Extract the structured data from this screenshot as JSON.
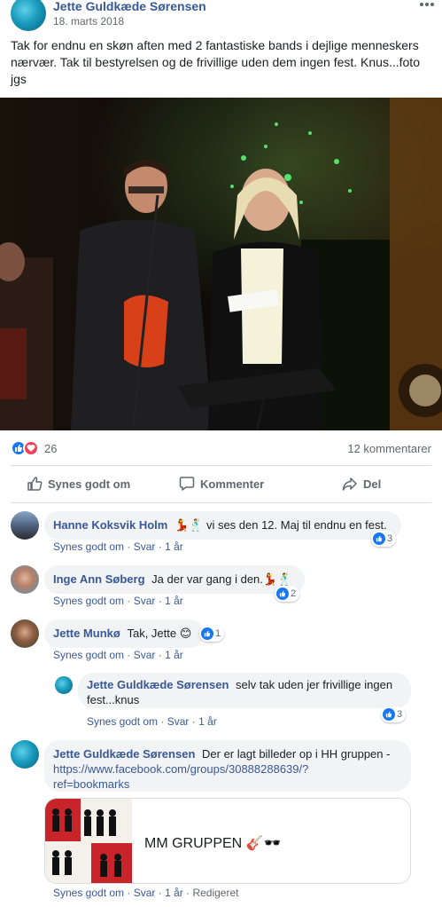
{
  "post": {
    "author": "Jette Guldkæde Sørensen",
    "date": "18. marts 2018",
    "text": "Tak for endnu en skøn aften med 2 fantastiske bands i dejlige menneskers nærvær. Tak til bestyrelsen og de frivillige uden dem ingen fest. Knus...foto jgs",
    "more_icon": "more-dots-icon",
    "reaction_count": "26",
    "comment_count": "12 kommentarer",
    "actions": {
      "like": "Synes godt om",
      "comment": "Kommenter",
      "share": "Del"
    }
  },
  "comments": [
    {
      "author": "Hanne Koksvik Holm",
      "text": "💃🕺 vi ses den 12. Maj til endnu en fest.",
      "like": "Synes godt om",
      "reply": "Svar",
      "time": "1 år",
      "reactions": "3"
    },
    {
      "author": "Inge Ann Søberg",
      "text": "Ja der var gang i den.💃🕺",
      "like": "Synes godt om",
      "reply": "Svar",
      "time": "1 år",
      "reactions": "2"
    },
    {
      "author": "Jette Munkø",
      "text": "Tak, Jette 😊",
      "like": "Synes godt om",
      "reply": "Svar",
      "time": "1 år",
      "reactions": "1"
    },
    {
      "author": "Jette Guldkæde Sørensen",
      "text": "selv tak uden jer frivillige ingen fest...knus",
      "like": "Synes godt om",
      "reply": "Svar",
      "time": "1 år",
      "reactions": "3"
    },
    {
      "author": "Jette Guldkæde Sørensen",
      "text": "Der er lagt billeder op i HH gruppen -",
      "link": "https://www.facebook.com/groups/30888288639/?ref=bookmarks",
      "link_line1": "https://www.facebook.com/groups/30888288639/?",
      "link_line2": "ref=bookmarks",
      "card_title": "MM GRUPPEN 🎸🕶️",
      "like": "Synes godt om",
      "reply": "Svar",
      "time": "1 år",
      "edited": "Redigeret"
    }
  ],
  "colors": {
    "link": "#385898",
    "bubble": "#f2f3f5",
    "like_blue": "#1877f2",
    "love_red": "#f33e58"
  }
}
